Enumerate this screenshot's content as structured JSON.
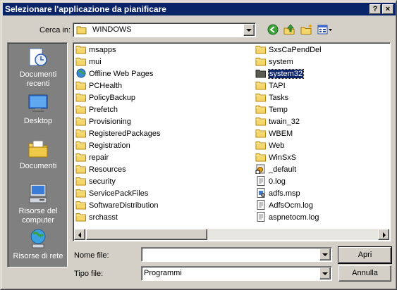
{
  "window": {
    "title": "Selezionare l'applicazione da pianificare"
  },
  "lookin": {
    "label": "Cerca in:",
    "value": "WINDOWS"
  },
  "toolbar": {
    "back_icon": "back-arrow-icon",
    "up_icon": "up-folder-icon",
    "newfolder_icon": "new-folder-icon",
    "views_icon": "views-menu-icon"
  },
  "places": [
    {
      "label": "Documenti recenti",
      "icon": "recent-documents-icon"
    },
    {
      "label": "Desktop",
      "icon": "desktop-icon"
    },
    {
      "label": "Documenti",
      "icon": "documents-folder-icon"
    },
    {
      "label": "Risorse del computer",
      "icon": "my-computer-icon"
    },
    {
      "label": "Risorse di rete",
      "icon": "network-icon"
    }
  ],
  "files_col1": [
    {
      "name": "msapps",
      "icon": "folder"
    },
    {
      "name": "mui",
      "icon": "folder"
    },
    {
      "name": "Offline Web Pages",
      "icon": "globe-folder"
    },
    {
      "name": "PCHealth",
      "icon": "folder"
    },
    {
      "name": "PolicyBackup",
      "icon": "folder"
    },
    {
      "name": "Prefetch",
      "icon": "folder"
    },
    {
      "name": "Provisioning",
      "icon": "folder"
    },
    {
      "name": "RegisteredPackages",
      "icon": "folder"
    },
    {
      "name": "Registration",
      "icon": "folder"
    },
    {
      "name": "repair",
      "icon": "folder"
    },
    {
      "name": "Resources",
      "icon": "folder"
    },
    {
      "name": "security",
      "icon": "folder"
    },
    {
      "name": "ServicePackFiles",
      "icon": "folder"
    },
    {
      "name": "SoftwareDistribution",
      "icon": "folder"
    },
    {
      "name": "srchasst",
      "icon": "folder"
    }
  ],
  "files_col2": [
    {
      "name": "SxsCaPendDel",
      "icon": "folder"
    },
    {
      "name": "system",
      "icon": "folder"
    },
    {
      "name": "system32",
      "icon": "folder-dark",
      "selected": true
    },
    {
      "name": "TAPI",
      "icon": "folder"
    },
    {
      "name": "Tasks",
      "icon": "folder"
    },
    {
      "name": "Temp",
      "icon": "folder"
    },
    {
      "name": "twain_32",
      "icon": "folder"
    },
    {
      "name": "WBEM",
      "icon": "folder"
    },
    {
      "name": "Web",
      "icon": "folder"
    },
    {
      "name": "WinSxS",
      "icon": "folder"
    },
    {
      "name": "_default",
      "icon": "shortcut-file"
    },
    {
      "name": "0.log",
      "icon": "text-file"
    },
    {
      "name": "adfs.msp",
      "icon": "msp-file"
    },
    {
      "name": "AdfsOcm.log",
      "icon": "text-file"
    },
    {
      "name": "aspnetocm.log",
      "icon": "text-file"
    }
  ],
  "filename": {
    "label": "Nome file:",
    "value": ""
  },
  "filetype": {
    "label": "Tipo file:",
    "value": "Programmi"
  },
  "buttons": {
    "open": "Apri",
    "cancel": "Annulla"
  },
  "colors": {
    "titlebar": "#0a246a",
    "face": "#d4d0c8",
    "places_bg": "#808080",
    "selection": "#0a246a"
  }
}
